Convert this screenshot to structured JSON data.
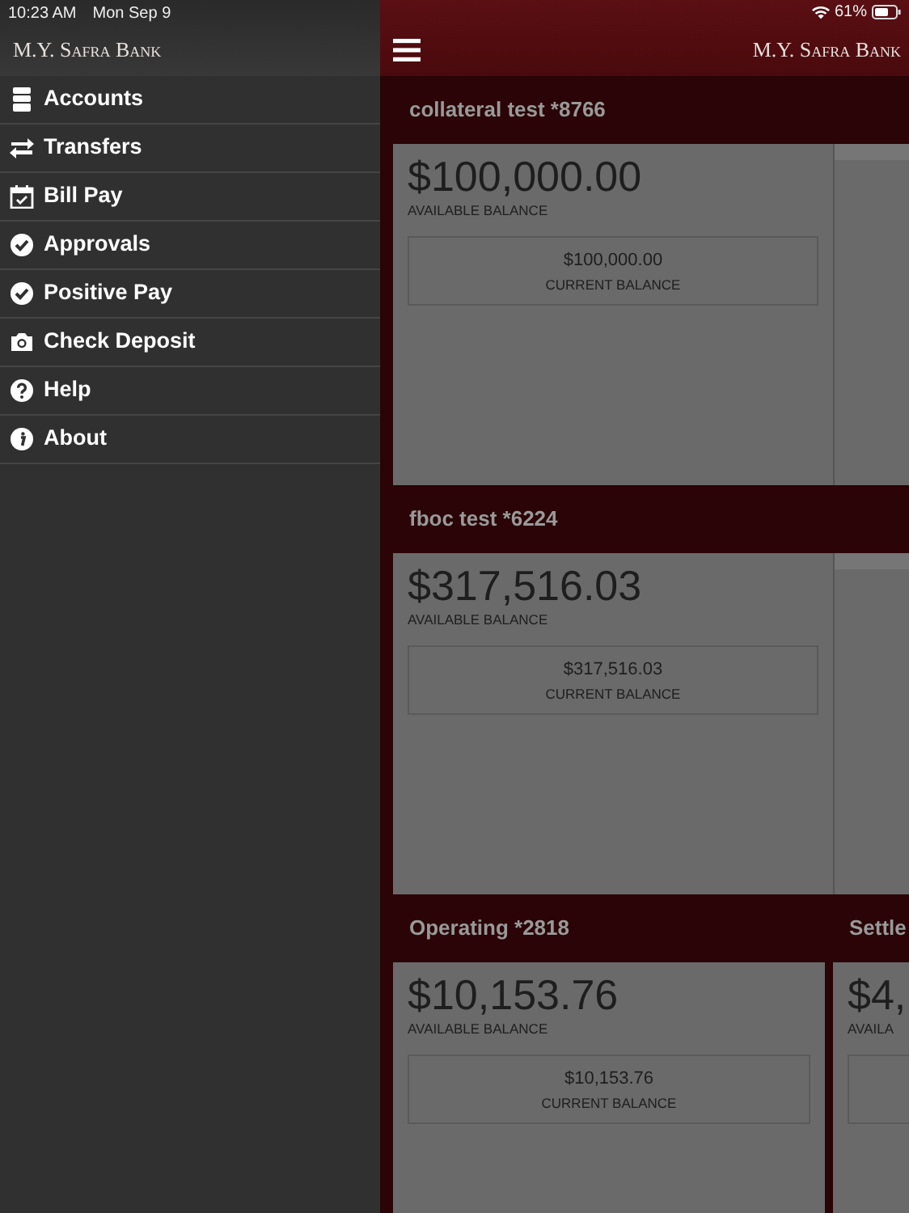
{
  "status_bar": {
    "time": "10:23 AM",
    "date": "Mon Sep 9",
    "battery": "61%"
  },
  "sidebar": {
    "logo": "M.Y. Safra Bank",
    "items": [
      {
        "label": "Accounts",
        "kind": "cabinet"
      },
      {
        "label": "Transfers",
        "kind": "arrows"
      },
      {
        "label": "Bill Pay",
        "kind": "calendar"
      },
      {
        "label": "Approvals",
        "kind": "check"
      },
      {
        "label": "Positive Pay",
        "kind": "check"
      },
      {
        "label": "Check Deposit",
        "kind": "camera"
      },
      {
        "label": "Help",
        "kind": "help"
      },
      {
        "label": "About",
        "kind": "info"
      }
    ]
  },
  "header": {
    "logo": "M.Y. Safra Bank"
  },
  "account_rows": [
    {
      "cards": [
        {
          "kind": "account",
          "title": "collateral test *8766",
          "available": "$100,000.00",
          "available_label": "AVAILABLE BALANCE",
          "current": "$100,000.00",
          "current_label": "CURRENT BALANCE"
        },
        {
          "kind": "blank"
        }
      ]
    },
    {
      "cards": [
        {
          "kind": "account",
          "title": "fboc test *6224",
          "available": "$317,516.03",
          "available_label": "AVAILABLE BALANCE",
          "current": "$317,516.03",
          "current_label": "CURRENT BALANCE"
        },
        {
          "kind": "blank"
        }
      ]
    },
    {
      "cards": [
        {
          "kind": "account",
          "title": "Operating *2818",
          "available": "$10,153.76",
          "available_label": "AVAILABLE BALANCE",
          "current": "$10,153.76",
          "current_label": "CURRENT BALANCE"
        },
        {
          "kind": "account",
          "title": "Settle",
          "available": "$4,",
          "available_label": "AVAILA"
        }
      ]
    }
  ]
}
